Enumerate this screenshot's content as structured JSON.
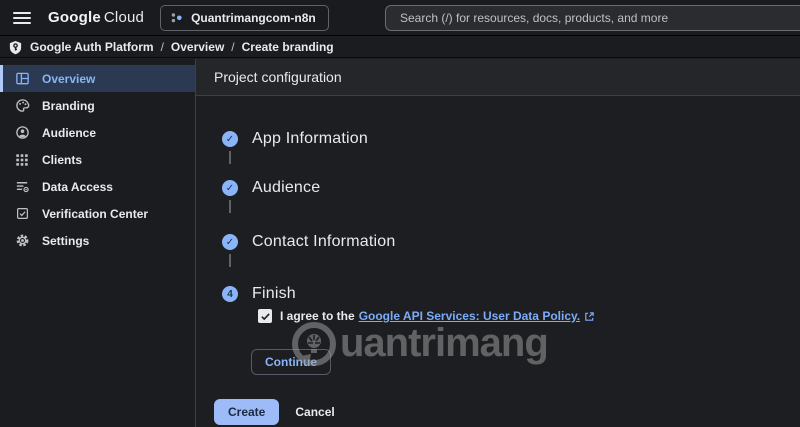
{
  "topbar": {
    "logo_google": "Google",
    "logo_cloud": "Cloud",
    "project_name": "Quantrimangcom-n8n",
    "search_placeholder": "Search (/) for resources, docs, products, and more"
  },
  "breadcrumb": {
    "separator": "/",
    "items": [
      "Google Auth Platform",
      "Overview",
      "Create branding"
    ]
  },
  "sidebar": {
    "items": [
      {
        "label": "Overview",
        "icon": "overview-icon",
        "selected": true
      },
      {
        "label": "Branding",
        "icon": "palette-icon",
        "selected": false
      },
      {
        "label": "Audience",
        "icon": "person-icon",
        "selected": false
      },
      {
        "label": "Clients",
        "icon": "grid-icon",
        "selected": false
      },
      {
        "label": "Data Access",
        "icon": "list-gear-icon",
        "selected": false
      },
      {
        "label": "Verification Center",
        "icon": "checkbox-check-icon",
        "selected": false
      },
      {
        "label": "Settings",
        "icon": "gear-icon",
        "selected": false
      }
    ]
  },
  "main": {
    "title": "Project configuration",
    "steps": [
      {
        "label": "App Information",
        "state": "complete"
      },
      {
        "label": "Audience",
        "state": "complete"
      },
      {
        "label": "Contact Information",
        "state": "complete"
      },
      {
        "label": "Finish",
        "state": "current",
        "number": "4"
      }
    ],
    "agreement": {
      "checked": true,
      "prefix": "I agree to the",
      "link_text": "Google API Services: User Data Policy."
    },
    "buttons": {
      "continue": "Continue",
      "create": "Create",
      "cancel": "Cancel"
    }
  },
  "watermark": {
    "text": "uantrimang"
  },
  "colors": {
    "accent_blue": "#8ab4f8",
    "selected_row_bg": "#2b3a52",
    "topbar_bg": "#1a1b1e",
    "content_bg": "#1d1e21",
    "header_strip_bg": "#242629",
    "text_primary": "#e8eaed",
    "text_secondary": "#bdc1c6",
    "link_blue": "#7cacf8",
    "create_button_bg": "#9cbbf7"
  }
}
